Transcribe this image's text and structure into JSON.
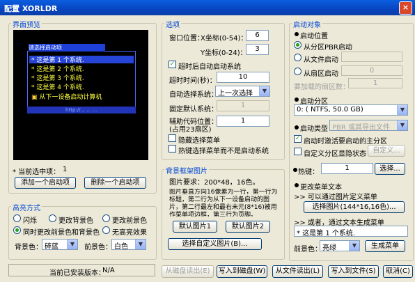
{
  "window": {
    "title": "配置  XORLDR",
    "close": "×"
  },
  "preview_group": {
    "title": "界面预览",
    "screen_title": "请选择启动项",
    "items": [
      "这是第 1 个系统.",
      "这是第 2 个系统.",
      "这是第 3 个系统.",
      "这是第 4 个系统."
    ],
    "item_marker": "*",
    "next_device": "从下一设备启动计算机",
    "status": "http://...  ...  ...",
    "current_label": "* 当前选中项：",
    "current_value": "1",
    "add_btn": "添加一个启动项",
    "delete_btn": "删除一个启动项"
  },
  "highlight_group": {
    "title": "高亮方式",
    "opt_blink": "闪烁",
    "opt_bg": "更改背景色",
    "opt_fg": "更改前景色",
    "opt_both": "同时更改前景色和背景色",
    "opt_none": "无高亮效果",
    "bg_label": "背景色：",
    "bg_value": "碎蓝",
    "fg_label": "前景色：",
    "fg_value": "白色"
  },
  "options_group": {
    "title": "选项",
    "win_pos": "窗口位置：",
    "x_label": "X坐标(0-54)：",
    "x_value": "6",
    "y_label": "Y坐标(0-24)：",
    "y_value": "3",
    "timeout_check": "超时后自动启动系统",
    "timeout_label": "超时时间(秒)：",
    "timeout_value": "10",
    "auto_label": "自动选择系统：",
    "auto_value": "上一次选择",
    "fixed_label": "固定默认系统：",
    "fixed_value": "1",
    "aux_label1": "辅助代码位置：",
    "aux_label2": "(占用23扇区)",
    "aux_value": "1",
    "hide_menu": "隐藏选择菜单",
    "hotkey_only": "热键选择菜单而不是启动系统"
  },
  "bg_group": {
    "title": "背景框架图片",
    "req": "图片要求：200*48，16色。",
    "desc": "图片垂直方向16像素为一行，第一行为标题，第二行为从下一设备启动的图片，第二行最左和最右未元(8*16)被用作菜单项边框，第三行为页脚。",
    "default1": "默认图片1",
    "default2": "默认图片2",
    "custom": "选择自定义图片(B)..."
  },
  "target_group": {
    "title": "启动对象",
    "boot_pos": "启动位置",
    "from_pbr": "从分区PBR启动",
    "from_file": "从文件启动",
    "from_sector": "从扇区启动",
    "sector_value": "0",
    "sectors_label": "要加载的扇区数：",
    "sectors_value": "1",
    "partition_label": "启动分区",
    "partition_value": "0: ( NTFS,  50.0 GB)",
    "type_label": "启动类型",
    "type_value": "PBR 或其导出文件",
    "activate": "启动时激活要启动的主分区",
    "custom_icon": "自定义分区显隐状态",
    "custom_btn": "自定义...",
    "hotkey_label": "热键：",
    "hotkey_value": "1",
    "hotkey_btn": "选择...",
    "menu_text_label": "更改菜单文本",
    "by_image": ">> 可以通过图片定义菜单",
    "choose_image": "选择图片(144*16,16色)...",
    "or_text": ">> 或者，通过文本生成菜单",
    "text_value": "* 这是第 1 个系统.",
    "fg_label": "前景色：",
    "fg_value": "亮绿",
    "gen_btn": "生成菜单"
  },
  "bottom": {
    "installed": "当前已安装版本：",
    "version": "N/A",
    "read_disk": "从磁盘读出(E)",
    "write_disk": "写入到磁盘(W)",
    "read_file": "从文件读出(L)",
    "write_file": "写入到文件(S)",
    "cancel": "取消(C)"
  }
}
